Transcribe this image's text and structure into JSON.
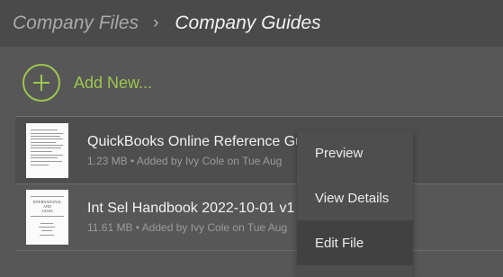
{
  "breadcrumb": {
    "root": "Company Files",
    "separator": "›",
    "current": "Company Guides"
  },
  "add_new": {
    "label": "Add New...",
    "icon": "plus-circle-icon"
  },
  "files": [
    {
      "name": "QuickBooks Online Reference Guide",
      "meta": "1.23 MB • Added by Ivy Cole on Tue Aug",
      "thumbnail": "document-thumbnail"
    },
    {
      "name": "Int Sel Handbook 2022-10-01 v1",
      "meta": "11.61 MB • Added by Ivy Cole on Tue Aug",
      "thumbnail": "handbook-cover-thumbnail"
    }
  ],
  "context_menu": {
    "items": [
      {
        "label": "Preview"
      },
      {
        "label": "View Details"
      },
      {
        "label": "Edit File"
      }
    ],
    "highlighted": "Edit File"
  },
  "colors": {
    "accent": "#9cc64e",
    "background": "#575757",
    "header": "#4a4a4a",
    "menu": "#4e4e4e"
  }
}
